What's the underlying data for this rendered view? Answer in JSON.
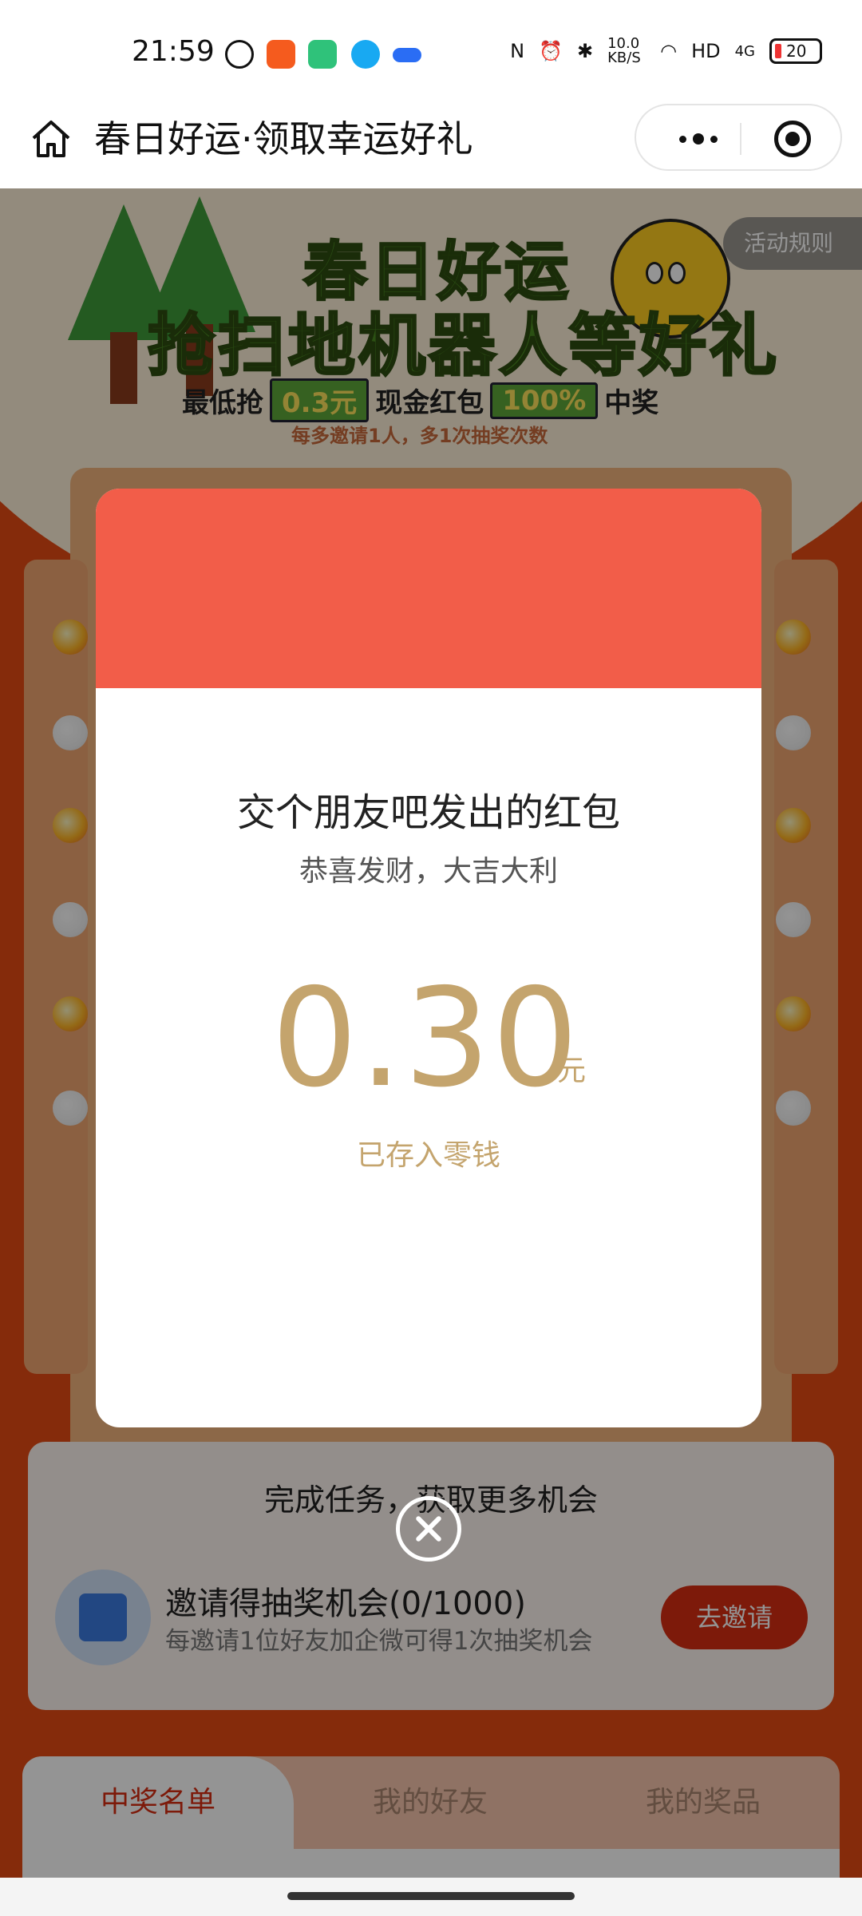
{
  "status_bar": {
    "time": "21:59",
    "net_speed": "10.0 KB/S",
    "signal": "4G",
    "battery": "20",
    "battery_color": "#e33333"
  },
  "nav": {
    "title": "春日好运·领取幸运好礼",
    "home_icon": "home-icon",
    "more_icon": "more-dots-icon",
    "close_icon": "target-icon"
  },
  "banner": {
    "headline_1": "春日好运",
    "headline_2": "抢扫地机器人等好礼",
    "sub_prefix": "最低抢",
    "sub_amount": "0.3元",
    "sub_middle": "现金红包",
    "sub_percent": "100%",
    "sub_suffix": "中奖",
    "invite_tip": "每多邀请1人，多1次抽奖次数",
    "rules": "活动规则"
  },
  "tasks": {
    "title": "完成任务，获取更多机会",
    "items": [
      {
        "name": "邀请得抽奖机会(0/1000)",
        "desc": "每邀请1位好友加企微可得1次抽奖机会",
        "button": "去邀请"
      }
    ]
  },
  "tabs": [
    {
      "label": "中奖名单",
      "active": true
    },
    {
      "label": "我的好友",
      "active": false
    },
    {
      "label": "我的奖品",
      "active": false
    }
  ],
  "modal": {
    "sender": "交个朋友吧发出的红包",
    "blessing": "恭喜发财，大吉大利",
    "amount": "0.30",
    "unit": "元",
    "status": "已存入零钱",
    "header_color": "#f25d49",
    "amount_color": "#c4a46d"
  },
  "colors": {
    "page_bg": "#e64a14",
    "accent_red": "#d72d12"
  }
}
